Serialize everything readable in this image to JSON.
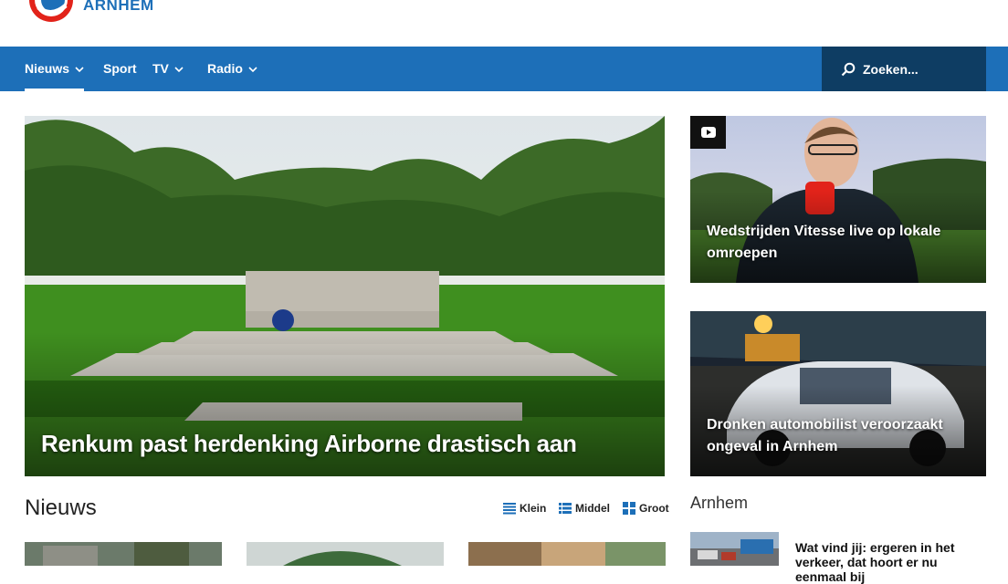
{
  "header": {
    "brand": "ARNHEM",
    "logo_icon": "rtv-logo-icon"
  },
  "nav": {
    "items": [
      {
        "label": "Nieuws",
        "has_dropdown": true,
        "active": true
      },
      {
        "label": "Sport",
        "has_dropdown": false,
        "active": false
      },
      {
        "label": "TV",
        "has_dropdown": true,
        "active": false
      },
      {
        "label": "Radio",
        "has_dropdown": true,
        "active": false
      }
    ],
    "search_label": "Zoeken..."
  },
  "featured": {
    "hero_title": "Renkum past herdenking Airborne drastisch aan",
    "side": [
      {
        "title": "Wedstrijden Vitesse live op lokale omroepen",
        "video": true
      },
      {
        "title": "Dronken automobilist veroorzaakt ongeval in Arnhem",
        "video": false
      }
    ]
  },
  "news": {
    "title": "Nieuws",
    "views": [
      "Klein",
      "Middel",
      "Groot"
    ]
  },
  "arnhem": {
    "title": "Arnhem",
    "headline": "Wat vind jij: ergeren in het verkeer, dat hoort er nu eenmaal bij"
  },
  "colors": {
    "brand_blue": "#1d6fb8",
    "search_bg": "#0e3d63",
    "logo_red": "#e2231a"
  }
}
